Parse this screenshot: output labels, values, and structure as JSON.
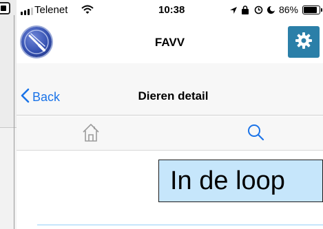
{
  "status_bar": {
    "carrier": "Telenet",
    "time": "10:38",
    "battery": "86%",
    "battery_level": 0.86,
    "icons": [
      "signal-icon",
      "wifi-icon",
      "location-icon",
      "lock-icon",
      "alarm-icon",
      "moon-icon",
      "battery-icon"
    ]
  },
  "header": {
    "title": "FAVV",
    "logo_icon": "logo-icon",
    "settings_icon": "gear-icon"
  },
  "nav": {
    "back_label": "Back",
    "title": "Dieren detail"
  },
  "tabs": [
    {
      "icon": "home-icon",
      "active": false
    },
    {
      "icon": "search-icon",
      "active": true
    }
  ],
  "content": {
    "status_text": "In de loop"
  },
  "colors": {
    "accent_blue": "#1a73e8",
    "settings_button": "#2b7fa8",
    "status_box_bg": "#c6e6fb"
  }
}
